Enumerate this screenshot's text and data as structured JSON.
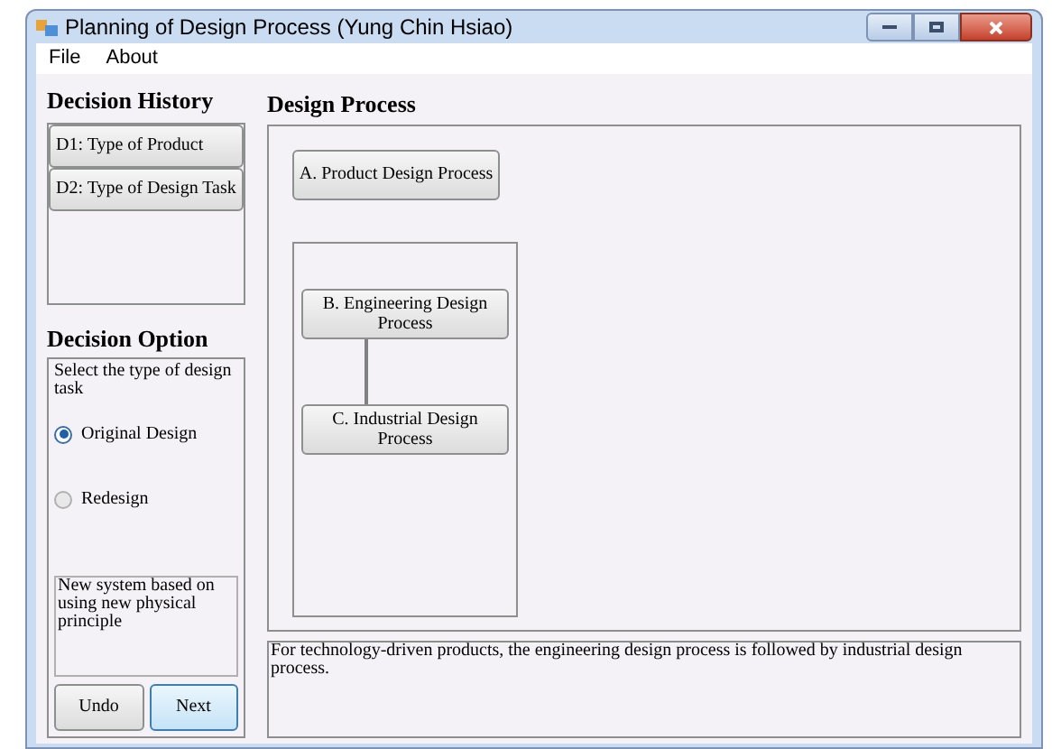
{
  "window": {
    "title": "Planning of Design Process (Yung Chin Hsiao)"
  },
  "menu": [
    "File",
    "About"
  ],
  "decision_history": {
    "title": "Decision History",
    "items": [
      {
        "label": "D1: Type of Product"
      },
      {
        "label": "D2: Type of Design Task"
      }
    ]
  },
  "decision_option": {
    "title": "Decision Option",
    "prompt": "Select the type of design task",
    "options": [
      {
        "label": "Original Design",
        "selected": true
      },
      {
        "label": "Redesign",
        "selected": false
      }
    ],
    "description": "New system based on using new physical principle",
    "buttons": [
      {
        "label": "Undo",
        "focused": false
      },
      {
        "label": "Next",
        "focused": true
      }
    ]
  },
  "design_process": {
    "title": "Design Process",
    "top_node": "A. Product Design Process",
    "group_nodes": [
      "B. Engineering Design Process",
      "C. Industrial Design Process"
    ]
  },
  "explanation": "For technology-driven products, the engineering design process is followed by industrial design process."
}
